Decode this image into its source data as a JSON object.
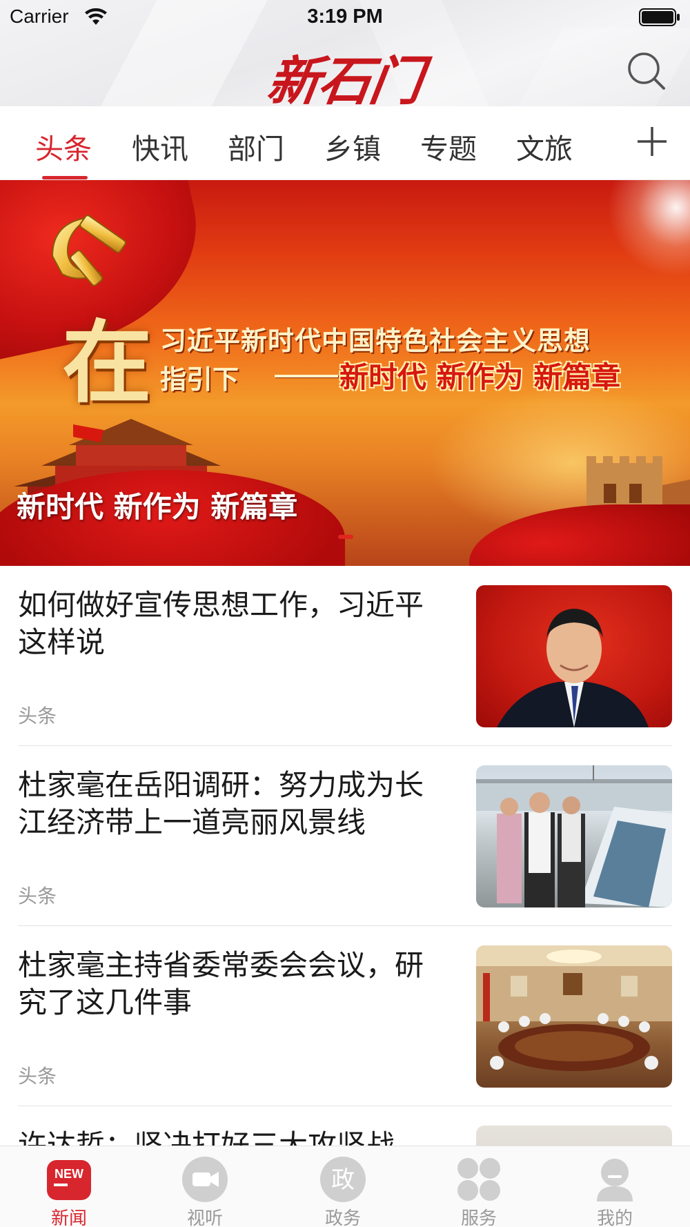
{
  "status_bar": {
    "carrier": "Carrier",
    "time": "3:19 PM"
  },
  "header": {
    "logo_text": "新石门",
    "search_icon": "search-icon"
  },
  "tabs": [
    {
      "label": "头条",
      "active": true
    },
    {
      "label": "快讯",
      "active": false
    },
    {
      "label": "部门",
      "active": false
    },
    {
      "label": "乡镇",
      "active": false
    },
    {
      "label": "专题",
      "active": false
    },
    {
      "label": "文旅",
      "active": false
    }
  ],
  "add_channel_icon": "plus-icon",
  "banner": {
    "big_char": "在",
    "line1": "习近平新时代中国特色社会主义思想",
    "line2a": "指引下",
    "line2b": "新时代 新作为 新篇章",
    "caption": "新时代 新作为 新篇章",
    "active_indicator": 1
  },
  "news": [
    {
      "title": "如何做好宣传思想工作，习近平这样说",
      "source": "头条"
    },
    {
      "title": "杜家毫在岳阳调研：努力成为长江经济带上一道亮丽风景线",
      "source": "头条"
    },
    {
      "title": "杜家毫主持省委常委会会议，研究了这几件事",
      "source": "头条"
    },
    {
      "title": "许达哲：坚决打好三大攻坚战",
      "source": ""
    }
  ],
  "tabbar": [
    {
      "label": "新闻",
      "icon": "news-new-icon",
      "badge": "NEW",
      "active": true
    },
    {
      "label": "视听",
      "icon": "video-camera-icon",
      "active": false
    },
    {
      "label": "政务",
      "icon": "government-icon",
      "glyph": "政",
      "active": false
    },
    {
      "label": "服务",
      "icon": "services-grid-icon",
      "active": false
    },
    {
      "label": "我的",
      "icon": "profile-icon",
      "active": false
    }
  ],
  "colors": {
    "accent": "#d8262e",
    "logo": "#c8161d",
    "inactive_tab_icon": "#cfcfcf",
    "muted_text": "#999999"
  }
}
